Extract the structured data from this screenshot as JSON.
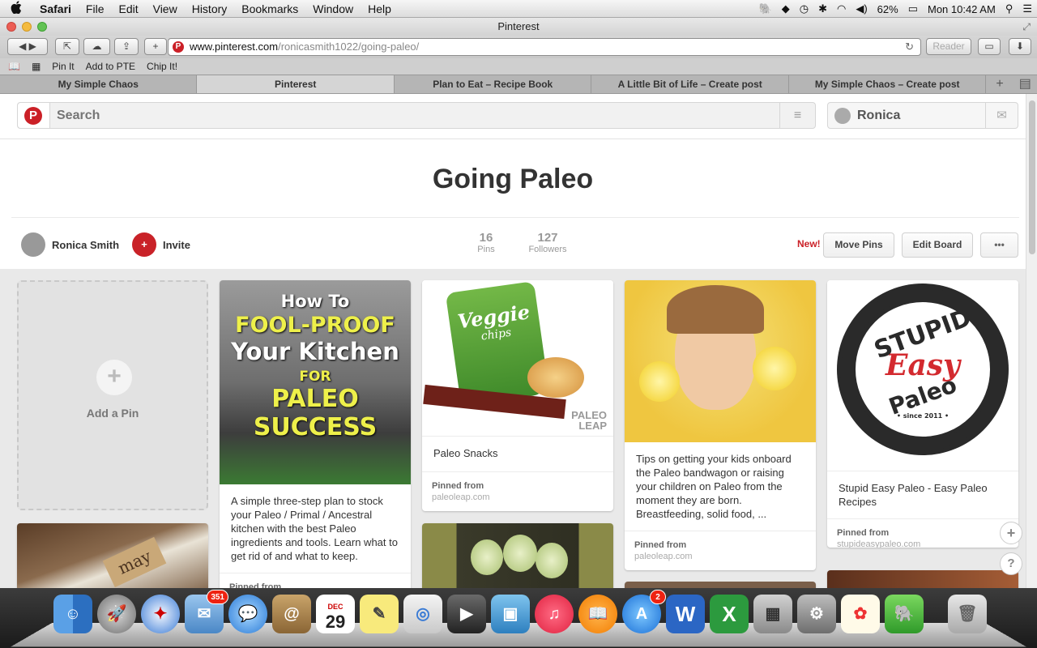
{
  "menubar": {
    "apple": "",
    "items": [
      "Safari",
      "File",
      "Edit",
      "View",
      "History",
      "Bookmarks",
      "Window",
      "Help"
    ],
    "battery": "62%",
    "clock": "Mon 10:42 AM"
  },
  "window": {
    "title": "Pinterest"
  },
  "toolbar": {
    "url_host": "www.pinterest.com",
    "url_path": "/ronicasmith1022/going-paleo/",
    "reader": "Reader"
  },
  "bookmarks": [
    "Pin It",
    "Add to PTE",
    "Chip It!"
  ],
  "tabs": [
    {
      "label": "My Simple Chaos",
      "active": false
    },
    {
      "label": "Pinterest",
      "active": true
    },
    {
      "label": "Plan to Eat – Recipe Book",
      "active": false
    },
    {
      "label": "A Little Bit of Life – Create post",
      "active": false
    },
    {
      "label": "My Simple Chaos – Create post",
      "active": false
    }
  ],
  "header": {
    "logo": "P",
    "search_placeholder": "Search",
    "menu_icon": "≡",
    "user_name": "Ronica",
    "notif_icon": "✉"
  },
  "board": {
    "title": "Going Paleo",
    "owner": "Ronica Smith",
    "invite": "Invite",
    "invite_icon": "+",
    "pins_count": "16",
    "pins_label": "Pins",
    "followers_count": "127",
    "followers_label": "Followers",
    "new_badge": "New!",
    "move_pins": "Move Pins",
    "edit_board": "Edit Board",
    "more": "•••"
  },
  "add_pin": {
    "label": "Add a Pin",
    "icon": "+"
  },
  "pins": [
    {
      "img_line1": "How To",
      "img_line2": "FOOL-PROOF",
      "img_line3": "Your Kitchen",
      "img_line4": "FOR",
      "img_line5": "PALEO",
      "img_line6": "SUCCESS",
      "description": "A simple three-step plan to stock your Paleo / Primal / Ancestral kitchen with the best Paleo ingredients and tools. Learn what to get rid of and what to keep.",
      "pinned_from": "Pinned from"
    },
    {
      "img_brand": "Veggie",
      "img_brand2": "chips",
      "img_logo": "PALEO",
      "img_logo2": "LEAP",
      "description": "Paleo Snacks",
      "pinned_from": "Pinned from",
      "source": "paleoleap.com"
    },
    {
      "description": "Tips on getting your kids onboard the Paleo bandwagon or raising your children on Paleo from the moment they are born. Breastfeeding, solid food, ...",
      "pinned_from": "Pinned from",
      "source": "paleoleap.com"
    },
    {
      "img_line1": "STUPID",
      "img_line2": "Easy",
      "img_line3": "Paleo",
      "img_since": "• since 2011 •",
      "description": "Stupid Easy Paleo - Easy Paleo Recipes",
      "pinned_from": "Pinned from",
      "source": "stupideasypaleo.com"
    }
  ],
  "jar_label": "may",
  "float_buttons": {
    "add": "+",
    "help": "?"
  },
  "dock": {
    "mail_badge": "351",
    "calendar_month": "DEC",
    "calendar_day": "29",
    "appstore_badge": "2"
  }
}
